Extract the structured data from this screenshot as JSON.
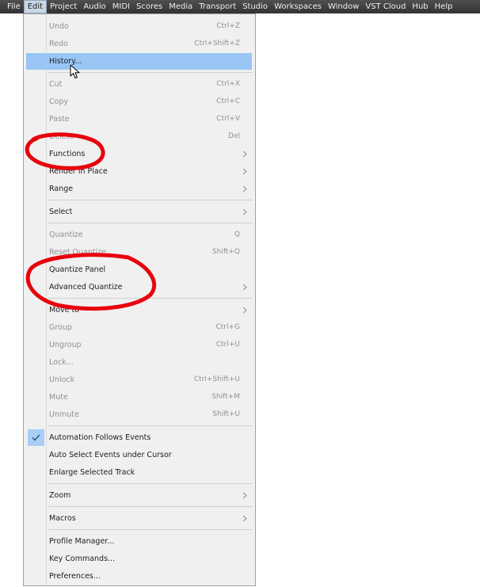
{
  "menubar": {
    "items": [
      "File",
      "Edit",
      "Project",
      "Audio",
      "MIDI",
      "Scores",
      "Media",
      "Transport",
      "Studio",
      "Workspaces",
      "Window",
      "VST Cloud",
      "Hub",
      "Help"
    ],
    "active": "Edit"
  },
  "edit_menu": {
    "items": [
      {
        "label": "Undo",
        "shortcut": "Ctrl+Z",
        "disabled": true
      },
      {
        "label": "Redo",
        "shortcut": "Ctrl+Shift+Z",
        "disabled": true
      },
      {
        "label": "History...",
        "highlighted": true
      },
      {
        "label": "Cut",
        "shortcut": "Ctrl+X",
        "disabled": true
      },
      {
        "label": "Copy",
        "shortcut": "Ctrl+C",
        "disabled": true
      },
      {
        "label": "Paste",
        "shortcut": "Ctrl+V",
        "disabled": true
      },
      {
        "label": "Delete",
        "shortcut": "Del",
        "disabled": true
      },
      {
        "label": "Functions",
        "submenu": true
      },
      {
        "label": "Render in Place",
        "submenu": true
      },
      {
        "label": "Range",
        "submenu": true
      },
      {
        "label": "Select",
        "submenu": true
      },
      {
        "label": "Quantize",
        "shortcut": "Q",
        "disabled": true
      },
      {
        "label": "Reset Quantize",
        "shortcut": "Shift+Q",
        "disabled": true
      },
      {
        "label": "Quantize Panel"
      },
      {
        "label": "Advanced Quantize",
        "submenu": true
      },
      {
        "label": "Move to",
        "submenu": true
      },
      {
        "label": "Group",
        "shortcut": "Ctrl+G",
        "disabled": true
      },
      {
        "label": "Ungroup",
        "shortcut": "Ctrl+U",
        "disabled": true
      },
      {
        "label": "Lock...",
        "disabled": true
      },
      {
        "label": "Unlock",
        "shortcut": "Ctrl+Shift+U",
        "disabled": true
      },
      {
        "label": "Mute",
        "shortcut": "Shift+M",
        "disabled": true
      },
      {
        "label": "Unmute",
        "shortcut": "Shift+U",
        "disabled": true
      },
      {
        "label": "Automation Follows Events",
        "checked": true
      },
      {
        "label": "Auto Select Events under Cursor"
      },
      {
        "label": "Enlarge Selected Track"
      },
      {
        "label": "Zoom",
        "submenu": true
      },
      {
        "label": "Macros",
        "submenu": true
      },
      {
        "label": "Profile Manager..."
      },
      {
        "label": "Key Commands..."
      },
      {
        "label": "Preferences..."
      }
    ]
  },
  "colors": {
    "menubar_bg": "#3c3c3c",
    "menu_bg": "#f0f0f0",
    "highlight": "#99c6f5",
    "disabled_text": "#909090",
    "annotation": "#e8000c"
  },
  "icons": {
    "submenu": "chevron-right-icon",
    "checked": "checkmark-icon",
    "cursor": "mouse-pointer-icon"
  }
}
